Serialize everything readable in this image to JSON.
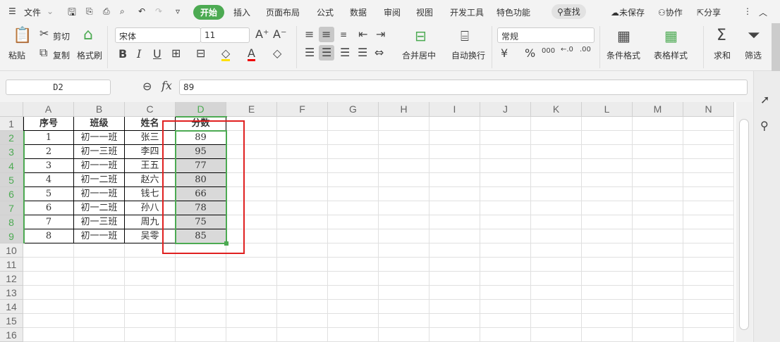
{
  "menu": {
    "file": "文件",
    "tabs": [
      "开始",
      "插入",
      "页面布局",
      "公式",
      "数据",
      "审阅",
      "视图",
      "开发工具",
      "特色功能"
    ],
    "search": "查找",
    "unsaved": "未保存",
    "collab": "协作",
    "share": "分享"
  },
  "ribbon": {
    "paste": "粘贴",
    "cut": "剪切",
    "copy": "复制",
    "format_painter": "格式刷",
    "font": "宋体",
    "size": "11",
    "merge": "合并居中",
    "wrap": "自动换行",
    "number_format": "常规",
    "cond_format": "条件格式",
    "table_style": "表格样式",
    "sum": "求和",
    "filter": "筛选"
  },
  "formula": {
    "name_box": "D2",
    "fx": "fx",
    "value": "89"
  },
  "columns": [
    "A",
    "B",
    "C",
    "D",
    "E",
    "F",
    "G",
    "H",
    "I",
    "J",
    "K",
    "L",
    "M",
    "N"
  ],
  "rows": [
    "1",
    "2",
    "3",
    "4",
    "5",
    "6",
    "7",
    "8",
    "9",
    "10",
    "11",
    "12",
    "13",
    "14",
    "15",
    "16"
  ],
  "table": {
    "headers": [
      "序号",
      "班级",
      "姓名",
      "分数"
    ],
    "data": [
      [
        "1",
        "初一一班",
        "张三",
        "89"
      ],
      [
        "2",
        "初一三班",
        "李四",
        "95"
      ],
      [
        "3",
        "初一一班",
        "王五",
        "77"
      ],
      [
        "4",
        "初一二班",
        "赵六",
        "80"
      ],
      [
        "5",
        "初一一班",
        "钱七",
        "66"
      ],
      [
        "6",
        "初一二班",
        "孙八",
        "78"
      ],
      [
        "7",
        "初一三班",
        "周九",
        "75"
      ],
      [
        "8",
        "初一一班",
        "吴零",
        "85"
      ]
    ]
  },
  "colors": {
    "accent": "#4caa52",
    "highlight": "#e02020"
  }
}
